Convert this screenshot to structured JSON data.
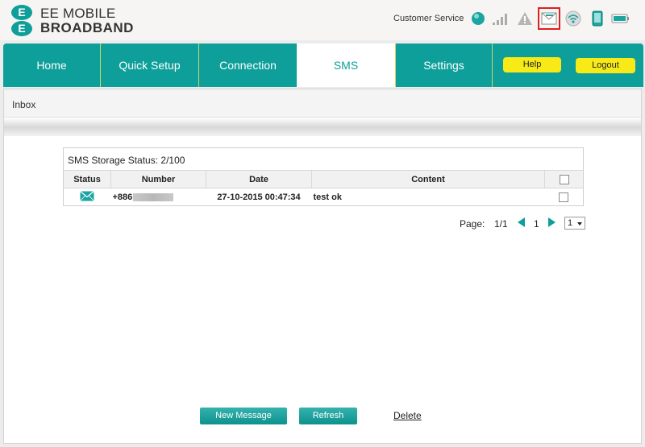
{
  "brand": {
    "line1": "EE MOBILE",
    "line2": "BROADBAND",
    "mark": "E"
  },
  "header": {
    "customer_service": "Customer Service"
  },
  "status_icons": [
    "network-status-icon",
    "signal-strength-icon",
    "warning-icon",
    "sms-icon",
    "wifi-icon",
    "device-icon",
    "battery-icon"
  ],
  "colors": {
    "accent": "#0e9f9a",
    "yellow": "#f7ea17",
    "highlight": "#e02020"
  },
  "nav": {
    "tabs": [
      {
        "label": "Home"
      },
      {
        "label": "Quick Setup"
      },
      {
        "label": "Connection"
      },
      {
        "label": "SMS",
        "active": true
      },
      {
        "label": "Settings"
      }
    ],
    "help": "Help",
    "logout": "Logout"
  },
  "inbox": {
    "title": "Inbox"
  },
  "sms": {
    "storage_status": "SMS Storage Status: 2/100",
    "columns": {
      "status": "Status",
      "number": "Number",
      "date": "Date",
      "content": "Content"
    },
    "rows": [
      {
        "number": "+886",
        "date": "27-10-2015 00:47:34",
        "content": "test ok"
      }
    ]
  },
  "pagination": {
    "label": "Page:",
    "pages": "1/1",
    "current": "1",
    "select_value": "1"
  },
  "actions": {
    "new_message": "New Message",
    "refresh": "Refresh",
    "delete": "Delete"
  }
}
